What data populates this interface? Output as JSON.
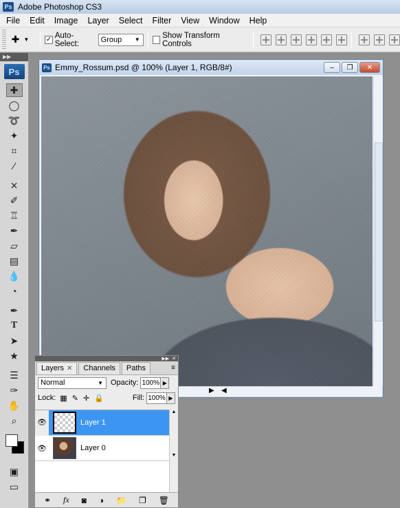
{
  "app": {
    "title": "Adobe Photoshop CS3",
    "logo_text": "Ps"
  },
  "menu": [
    "File",
    "Edit",
    "Image",
    "Layer",
    "Select",
    "Filter",
    "View",
    "Window",
    "Help"
  ],
  "options_bar": {
    "auto_select_label": "Auto-Select:",
    "auto_select_checked": true,
    "auto_select_value": "Group",
    "show_transform_label": "Show Transform Controls",
    "show_transform_checked": false
  },
  "toolbox": {
    "logo_text": "Ps",
    "tools": [
      "move-tool",
      "marquee-tool",
      "lasso-tool",
      "magic-wand-tool",
      "crop-tool",
      "eyedropper-tool",
      "healing-brush-tool",
      "brush-tool",
      "clone-stamp-tool",
      "history-brush-tool",
      "eraser-tool",
      "gradient-tool",
      "blur-tool",
      "dodge-tool",
      "pen-tool",
      "type-tool",
      "path-selection-tool",
      "shape-tool",
      "notes-tool",
      "eyedropper2-tool",
      "hand-tool",
      "zoom-tool"
    ],
    "foreground_color": "#ffffff",
    "background_color": "#000000"
  },
  "document": {
    "title": "Emmy_Rossum.psd @ 100% (Layer 1, RGB/8#)"
  },
  "layers_panel": {
    "tabs": [
      {
        "label": "Layers",
        "active": true
      },
      {
        "label": "Channels",
        "active": false
      },
      {
        "label": "Paths",
        "active": false
      }
    ],
    "blend_mode": "Normal",
    "opacity_label": "Opacity:",
    "opacity_value": "100%",
    "lock_label": "Lock:",
    "fill_label": "Fill:",
    "fill_value": "100%",
    "layers": [
      {
        "name": "Layer 1",
        "selected": true,
        "visible": true
      },
      {
        "name": "Layer 0",
        "selected": false,
        "visible": true
      }
    ]
  }
}
